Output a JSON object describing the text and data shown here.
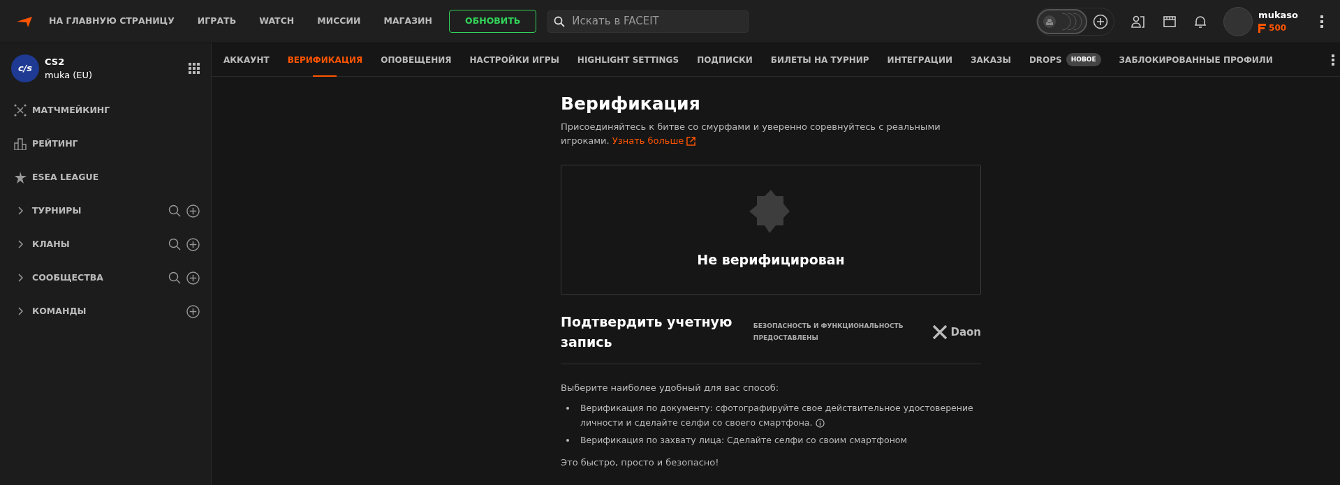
{
  "topbar": {
    "nav": [
      "НА ГЛАВНУЮ СТРАНИЦУ",
      "ИГРАТЬ",
      "WATCH",
      "МИССИИ",
      "МАГАЗИН"
    ],
    "upgrade_button": "ОБНОВИТЬ",
    "search": {
      "placeholder": "Искать в FACEIT"
    },
    "user": {
      "name": "mukaso",
      "balance": "500"
    }
  },
  "sidebar": {
    "game": {
      "title": "CS2",
      "subtitle": "muka (EU)",
      "logo": "c/s"
    },
    "items": [
      {
        "kind": "link",
        "label": "МАТЧМЕЙКИНГ"
      },
      {
        "kind": "link",
        "label": "РЕЙТИНГ"
      },
      {
        "kind": "link",
        "label": "ESEA LEAGUE"
      },
      {
        "kind": "group",
        "label": "ТУРНИРЫ",
        "expanded": false,
        "search": true,
        "add": true
      },
      {
        "kind": "group",
        "label": "КЛАНЫ",
        "expanded": false,
        "search": true,
        "add": true
      },
      {
        "kind": "group",
        "label": "СООБЩЕСТВА",
        "expanded": false,
        "search": true,
        "add": true
      },
      {
        "kind": "group",
        "label": "КОМАНДЫ",
        "expanded": false,
        "search": false,
        "add": true
      }
    ]
  },
  "tabs": [
    {
      "label": "АККАУНТ",
      "selected": false
    },
    {
      "label": "ВЕРИФИКАЦИЯ",
      "selected": true
    },
    {
      "label": "ОПОВЕЩЕНИЯ",
      "selected": false
    },
    {
      "label": "НАСТРОЙКИ ИГРЫ",
      "selected": false
    },
    {
      "label": "HIGHLIGHT SETTINGS",
      "selected": false
    },
    {
      "label": "ПОДПИСКИ",
      "selected": false
    },
    {
      "label": "БИЛЕТЫ НА ТУРНИР",
      "selected": false
    },
    {
      "label": "ИНТЕГРАЦИИ",
      "selected": false
    },
    {
      "label": "ЗАКАЗЫ",
      "selected": false
    },
    {
      "label": "DROPS",
      "selected": false,
      "badge": "НОВОЕ"
    },
    {
      "label": "ЗАБЛОКИРОВАННЫЕ ПРОФИЛИ",
      "selected": false
    }
  ],
  "content": {
    "title": "Верификация",
    "description": "Присоединяйтесь к битве со смурфами и уверенно соревнуйтесь с реальными игроками.",
    "learn_more": "Узнать больше",
    "status": {
      "verified": false,
      "label": "Не верифицирован"
    },
    "confirm_title": "Подтвердить учетную запись",
    "provider_note": "БЕЗОПАСНОСТЬ И ФУНКЦИОНАЛЬНОСТЬ ПРЕДОСТАВЛЕНЫ",
    "provider": "Daon",
    "intro": "Выберите наиболее удобный для вас способ:",
    "methods": [
      {
        "text": "Верификация по документу: сфотографируйте свое действительное удостоверение личности и сделайте селфи со своего смартфона.",
        "info": true
      },
      {
        "text": "Верификация по захвату лица: Сделайте селфи со своим смартфоном",
        "info": false
      }
    ],
    "footer": "Это быстро, просто и безопасно!"
  }
}
